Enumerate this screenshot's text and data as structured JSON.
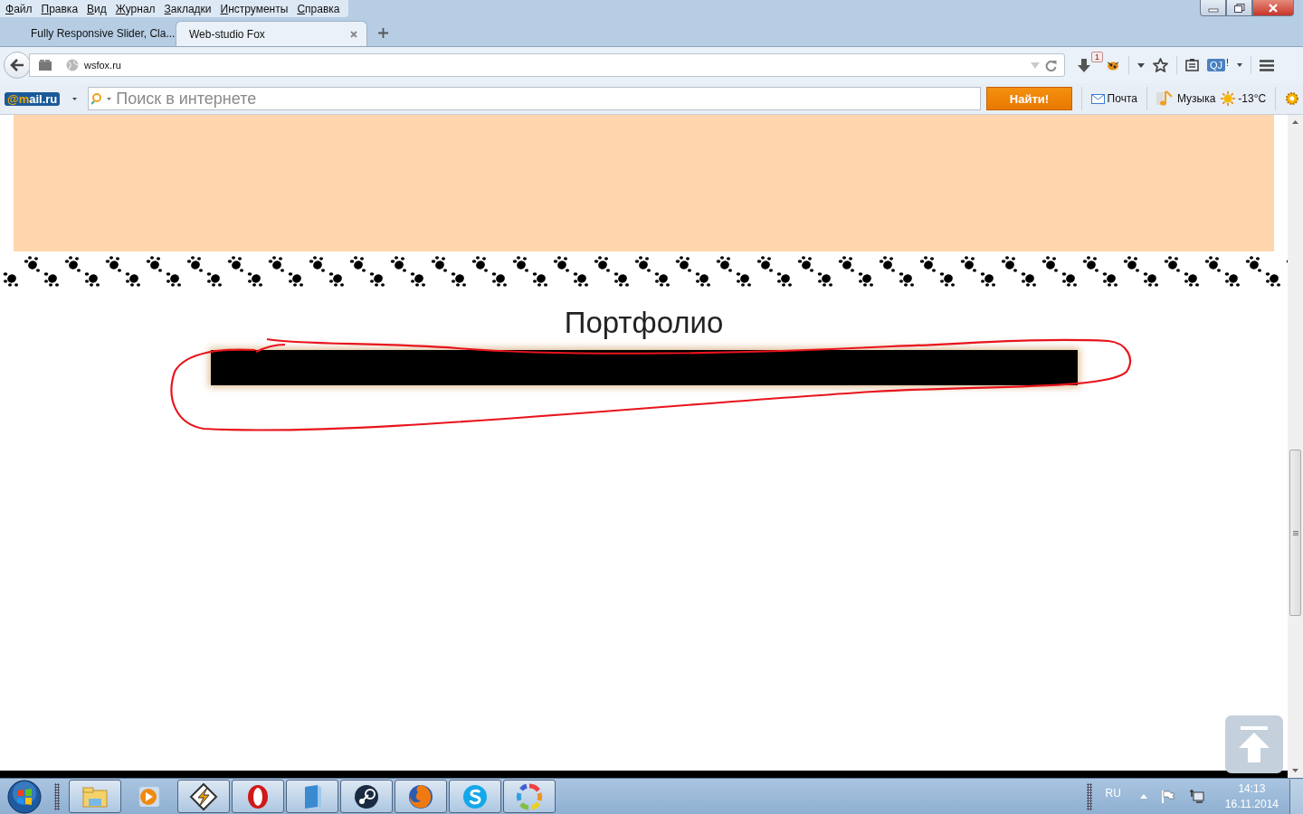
{
  "menu_bar": {
    "items": [
      {
        "label": "Файл"
      },
      {
        "label": "Правка"
      },
      {
        "label": "Вид"
      },
      {
        "label": "Журнал"
      },
      {
        "label": "Закладки"
      },
      {
        "label": "Инструменты"
      },
      {
        "label": "Справка"
      }
    ]
  },
  "tabs": [
    {
      "title": "Fully Responsive Slider, Cla...",
      "selected": false
    },
    {
      "title": "Web-studio Fox",
      "selected": true
    }
  ],
  "address_bar": {
    "url": "wsfox.ru"
  },
  "toolbar": {
    "notification_count": "1",
    "addon_label": "QJ",
    "addon_mark": "!"
  },
  "mail_bar": {
    "logo": "@mail.ru",
    "search_placeholder": "Поиск в интернете",
    "search_button": "Найти!",
    "links": [
      {
        "kind": "mail",
        "label": "Почта"
      },
      {
        "kind": "music",
        "label": "Музыка"
      }
    ],
    "weather": "-13°C"
  },
  "page": {
    "heading": "Портфолио"
  },
  "taskbar": {
    "apps": [
      {
        "kind": "explorer",
        "running": true
      },
      {
        "kind": "media",
        "running": false
      },
      {
        "kind": "winamp",
        "running": true
      },
      {
        "kind": "opera",
        "running": true
      },
      {
        "kind": "book",
        "running": true
      },
      {
        "kind": "steam",
        "running": true
      },
      {
        "kind": "firefox",
        "running": true
      },
      {
        "kind": "skype",
        "running": true
      },
      {
        "kind": "ring",
        "running": true
      }
    ],
    "language": "RU",
    "time": "14:13",
    "date": "16.11.2014"
  }
}
